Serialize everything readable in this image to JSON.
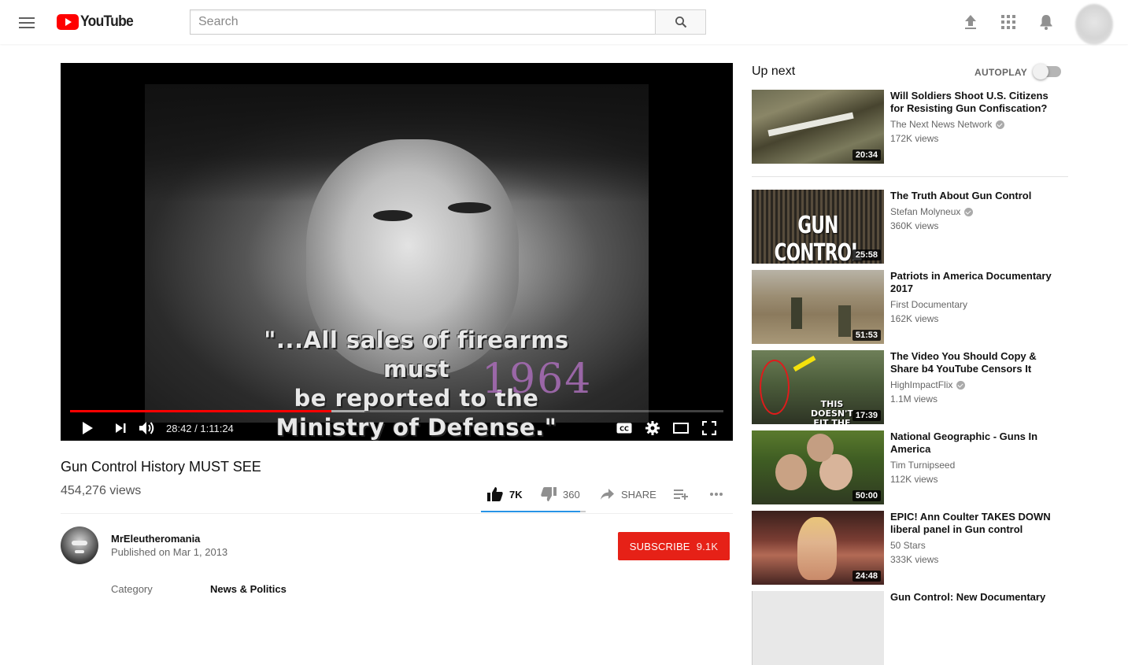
{
  "header": {
    "logo_text": "YouTube",
    "search_placeholder": "Search"
  },
  "player": {
    "caption_line1": "\"...All sales of firearms must",
    "caption_line2": "be reported to the",
    "caption_line3": "Ministry of Defense.\"",
    "year_overlay": "1964",
    "time_display": "28:42 / 1:11:24",
    "progress_played": 0.4,
    "progress_buffered": 0.45
  },
  "video": {
    "title": "Gun Control History MUST SEE",
    "views": "454,276 views",
    "likes": "7K",
    "dislikes": "360",
    "share_label": "SHARE",
    "like_ratio": 0.95,
    "channel": {
      "name": "MrEleutheromania",
      "published": "Published on Mar 1, 2013"
    },
    "subscribe_label": "SUBSCRIBE",
    "subscriber_count": "9.1K",
    "category_label": "Category",
    "category_value": "News & Politics"
  },
  "sidebar": {
    "up_next_label": "Up next",
    "autoplay_label": "AUTOPLAY",
    "items": [
      {
        "title": "Will Soldiers Shoot U.S. Citizens for Resisting Gun Confiscation?",
        "channel": "The Next News Network",
        "verified": true,
        "views": "172K views",
        "duration": "20:34"
      },
      {
        "title": "The Truth About Gun Control",
        "channel": "Stefan Molyneux",
        "verified": true,
        "views": "360K views",
        "duration": "25:58",
        "thumb_text": "GUN CONTROL"
      },
      {
        "title": "Patriots in America Documentary 2017",
        "channel": "First Documentary",
        "verified": false,
        "views": "162K views",
        "duration": "51:53"
      },
      {
        "title": "The Video You Should Copy & Share b4 YouTube Censors It",
        "channel": "HighImpactFlix",
        "verified": true,
        "views": "1.1M views",
        "duration": "17:39",
        "thumb_text": "THIS DOESN'T FIT THE NARR"
      },
      {
        "title": "National Geographic - Guns In America",
        "channel": "Tim Turnipseed",
        "verified": false,
        "views": "112K views",
        "duration": "50:00"
      },
      {
        "title": "EPIC! Ann Coulter TAKES DOWN liberal panel in Gun control",
        "channel": "50 Stars",
        "verified": false,
        "views": "333K views",
        "duration": "24:48"
      },
      {
        "title": "Gun Control: New Documentary"
      }
    ]
  }
}
